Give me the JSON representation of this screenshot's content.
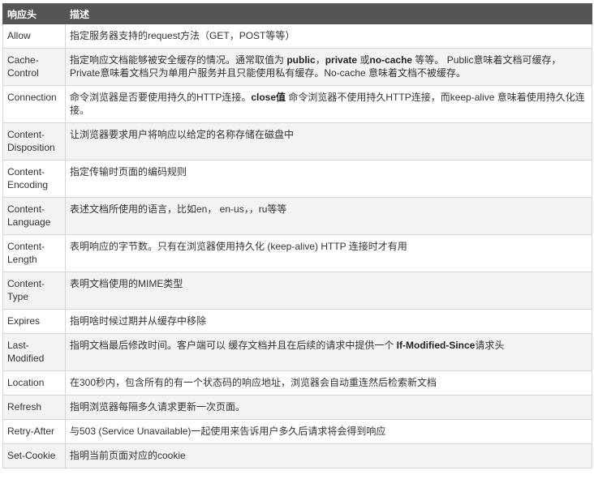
{
  "header": {
    "col1": "响应头",
    "col2": "描述"
  },
  "rows": [
    {
      "name": "Allow",
      "lines": 1,
      "desc": [
        {
          "t": "指定服务器支持的request方法（GET，POST等等）"
        }
      ]
    },
    {
      "name": "Cache-Control",
      "lines": 2,
      "desc": [
        {
          "t": "指定响应文档能够被安全缓存的情况。通常取值为 "
        },
        {
          "t": "public",
          "b": true
        },
        {
          "t": "，"
        },
        {
          "t": "private",
          "b": true
        },
        {
          "t": " 或"
        },
        {
          "t": "no-cache",
          "b": true
        },
        {
          "t": " 等等。 Public意味着文档可缓存，Private意味着文档只为单用户服务并且只能使用私有缓存。No-cache 意味着文档不被缓存。"
        }
      ]
    },
    {
      "name": "Connection",
      "lines": 2,
      "desc": [
        {
          "t": "命令浏览器是否要使用持久的HTTP连接。"
        },
        {
          "t": "close值",
          "b": true
        },
        {
          "t": " 命令浏览器不使用持久HTTP连接，而keep-alive 意味着使用持久化连接。"
        }
      ]
    },
    {
      "name": "Content-Disposition",
      "lines": 2,
      "desc": [
        {
          "t": "让浏览器要求用户将响应以给定的名称存储在磁盘中"
        }
      ]
    },
    {
      "name": "Content-Encoding",
      "lines": 2,
      "desc": [
        {
          "t": "指定传输时页面的编码规则"
        }
      ]
    },
    {
      "name": "Content-Language",
      "lines": 2,
      "desc": [
        {
          "t": "表述文档所使用的语言，比如en， en-us，，ru等等"
        }
      ]
    },
    {
      "name": "Content-Length",
      "lines": 2,
      "desc": [
        {
          "t": "表明响应的字节数。只有在浏览器使用持久化 (keep-alive) HTTP 连接时才有用"
        }
      ]
    },
    {
      "name": "Content-Type",
      "lines": 2,
      "desc": [
        {
          "t": "表明文档使用的MIME类型"
        }
      ]
    },
    {
      "name": "Expires",
      "lines": 1,
      "desc": [
        {
          "t": "指明啥时候过期并从缓存中移除"
        }
      ]
    },
    {
      "name": "Last-Modified",
      "lines": 2,
      "desc": [
        {
          "t": "指明文档最后修改时间。客户端可以 缓存文档并且在后续的请求中提供一个 "
        },
        {
          "t": "If-Modified-Since",
          "b": true
        },
        {
          "t": "请求头"
        }
      ]
    },
    {
      "name": "Location",
      "lines": 1,
      "desc": [
        {
          "t": "在300秒内，包含所有的有一个状态码的响应地址，浏览器会自动重连然后检索新文档"
        }
      ]
    },
    {
      "name": "Refresh",
      "lines": 1,
      "desc": [
        {
          "t": "指明浏览器每隔多久请求更新一次页面。"
        }
      ]
    },
    {
      "name": "Retry-After",
      "lines": 1,
      "desc": [
        {
          "t": "与503 (Service Unavailable)一起使用来告诉用户多久后请求将会得到响应"
        }
      ]
    },
    {
      "name": "Set-Cookie",
      "lines": 1,
      "desc": [
        {
          "t": "指明当前页面对应的cookie"
        }
      ]
    }
  ]
}
